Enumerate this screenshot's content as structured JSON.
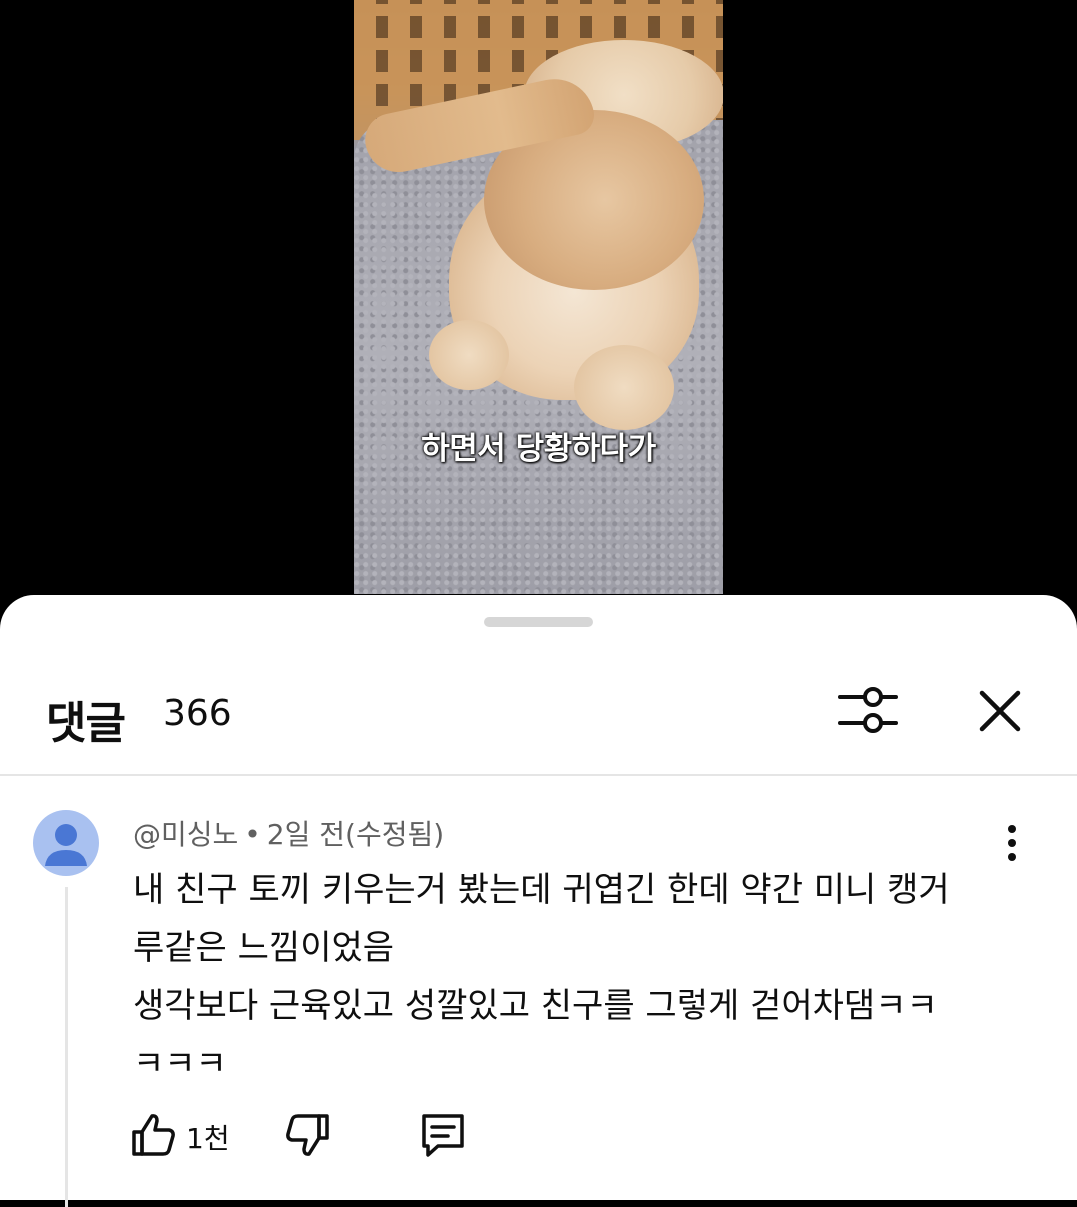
{
  "video": {
    "subtitle": "하면서 당황하다가"
  },
  "comments_panel": {
    "title": "댓글",
    "count": "366",
    "filter_icon": "sliders-icon",
    "close_icon": "close-icon"
  },
  "comment": {
    "author": "@미싱노",
    "separator": "•",
    "time": "2일 전(수정됨)",
    "lines": [
      "내 친구 토끼 키우는거 봤는데 귀엽긴 한데 약간 미니 캥거",
      "루같은 느낌이었음",
      "생각보다 근육있고 성깔있고 친구를 그렇게 걷어차댐ㅋㅋ",
      "ㅋㅋㅋ"
    ],
    "like_count": "1천",
    "icons": {
      "avatar": "default-avatar-icon",
      "more": "more-vertical-icon",
      "like": "thumbs-up-icon",
      "dislike": "thumbs-down-icon",
      "reply": "reply-comment-icon"
    },
    "avatar_color": "#a9c1f0"
  }
}
